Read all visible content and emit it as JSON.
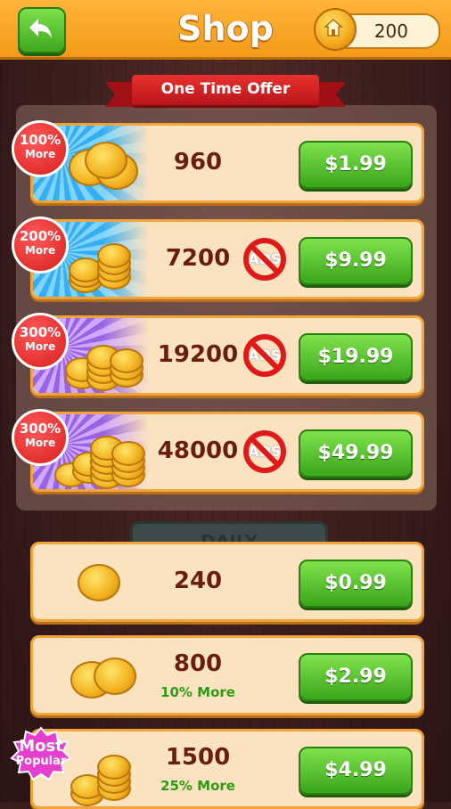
{
  "header": {
    "title": "Shop",
    "coin_balance": "200"
  },
  "offer": {
    "ribbon": "One Time Offer",
    "items": [
      {
        "badge_pct": "100%",
        "badge_label": "More",
        "amount": "960",
        "price": "$1.99",
        "no_ads": false,
        "art": "blue"
      },
      {
        "badge_pct": "200%",
        "badge_label": "More",
        "amount": "7200",
        "price": "$9.99",
        "no_ads": true,
        "no_ads_text": "ADS",
        "art": "blue"
      },
      {
        "badge_pct": "300%",
        "badge_label": "More",
        "amount": "19200",
        "price": "$19.99",
        "no_ads": true,
        "no_ads_text": "ADS",
        "art": "purple"
      },
      {
        "badge_pct": "300%",
        "badge_label": "More",
        "amount": "48000",
        "price": "$49.99",
        "no_ads": true,
        "no_ads_text": "ADS",
        "art": "purple"
      }
    ]
  },
  "daily_label": "DAILY",
  "packs": [
    {
      "amount": "240",
      "bonus": "",
      "price": "$0.99"
    },
    {
      "amount": "800",
      "bonus": "10% More",
      "price": "$2.99"
    },
    {
      "amount": "1500",
      "bonus": "25% More",
      "price": "$4.99",
      "tag_line1": "Most",
      "tag_line2": "Popular"
    }
  ],
  "colors": {
    "header": "#f39a18",
    "button_green": "#3aa61a",
    "badge_red": "#d81d1d",
    "badge_pink": "#e63fd0",
    "row_bg": "#fbe3c0"
  }
}
